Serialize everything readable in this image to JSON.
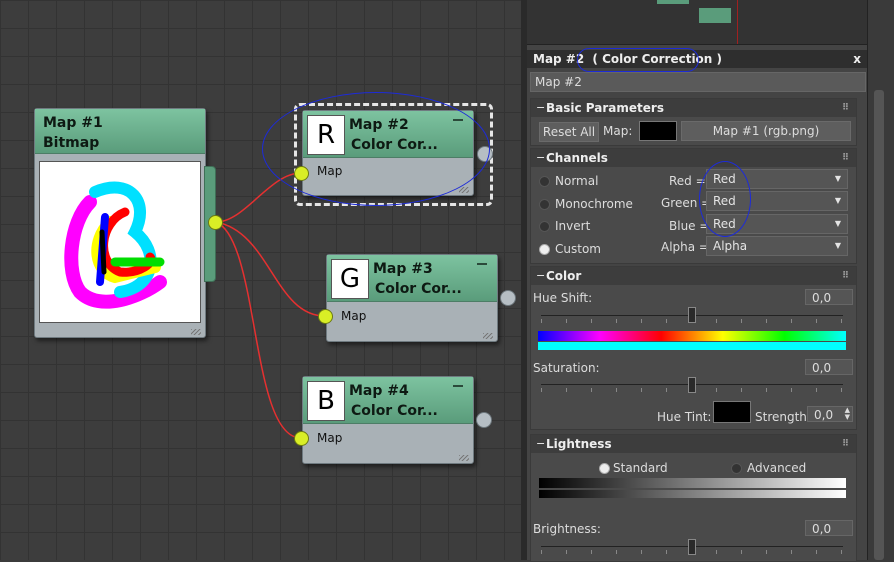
{
  "nodes": {
    "map1": {
      "title_line1": "Map #1",
      "title_line2": "Bitmap"
    },
    "map2": {
      "title_line1": "Map #2",
      "title_line2": "Color Cor...",
      "thumb_letter": "R",
      "port_label": "Map"
    },
    "map3": {
      "title_line1": "Map #3",
      "title_line2": "Color Cor...",
      "thumb_letter": "G",
      "port_label": "Map"
    },
    "map4": {
      "title_line1": "Map #4",
      "title_line2": "Color Cor...",
      "thumb_letter": "B",
      "port_label": "Map"
    }
  },
  "panel": {
    "title": "Map #2",
    "title_type": "( Color Correction )",
    "close": "x",
    "name_field": "Map #2",
    "basic": {
      "header": "Basic Parameters",
      "reset_label": "Reset All",
      "map_label": "Map:",
      "map_button": "Map #1 (rgb.png)"
    },
    "channels": {
      "header": "Channels",
      "options": [
        {
          "label": "Normal",
          "selected": false
        },
        {
          "label": "Monochrome",
          "selected": false
        },
        {
          "label": "Invert",
          "selected": false
        },
        {
          "label": "Custom",
          "selected": true
        }
      ],
      "mappings": [
        {
          "label": "Red =",
          "value": "Red"
        },
        {
          "label": "Green =",
          "value": "Red"
        },
        {
          "label": "Blue =",
          "value": "Red"
        },
        {
          "label": "Alpha =",
          "value": "Alpha"
        }
      ]
    },
    "color": {
      "header": "Color",
      "hue_shift_label": "Hue Shift:",
      "hue_shift_value": "0,0",
      "saturation_label": "Saturation:",
      "saturation_value": "0,0",
      "hue_tint_label": "Hue Tint:",
      "strength_label": "Strength:",
      "strength_value": "0,0"
    },
    "lightness": {
      "header": "Lightness",
      "standard_label": "Standard",
      "advanced_label": "Advanced",
      "standard_selected": true,
      "brightness_label": "Brightness:",
      "brightness_value": "0,0"
    }
  },
  "colors": {
    "node_header": "#5a9c7b",
    "wire": "#e53030",
    "input_socket": "#d9ee26",
    "annotation": "#1d2bd8"
  }
}
